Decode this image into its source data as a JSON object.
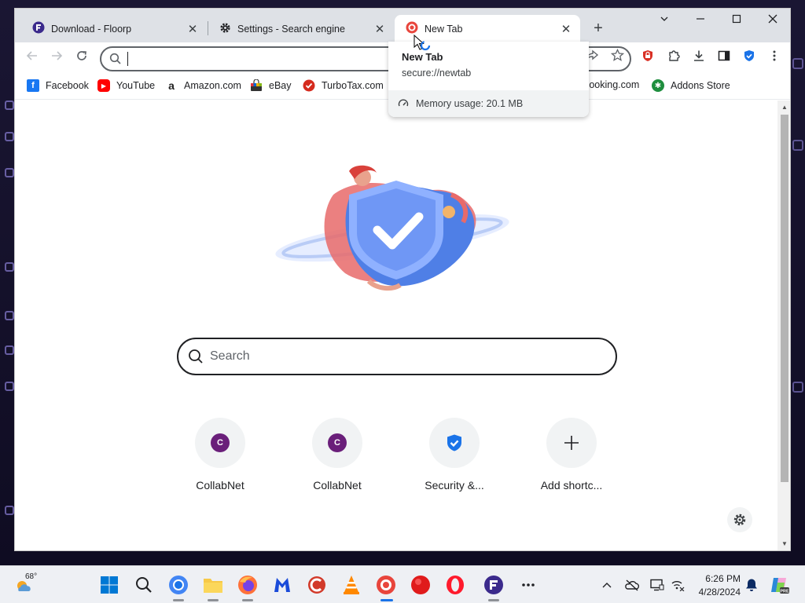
{
  "tabs": [
    {
      "title": "Download - Floorp",
      "favicon": "floorp-icon",
      "active": false
    },
    {
      "title": "Settings - Search engine",
      "favicon": "gear-icon",
      "active": false
    },
    {
      "title": "New Tab",
      "favicon": "browser-logo-icon",
      "active": true
    }
  ],
  "omnibox": {
    "value": "",
    "placeholder": ""
  },
  "bookmarks": [
    {
      "label": "Facebook",
      "icon": "facebook-icon",
      "color": "#1877f2"
    },
    {
      "label": "YouTube",
      "icon": "youtube-icon",
      "color": "#ff0000"
    },
    {
      "label": "Amazon.com",
      "icon": "amazon-icon",
      "color": "#222222"
    },
    {
      "label": "eBay",
      "icon": "ebay-icon",
      "color": "#e53238"
    },
    {
      "label": "TurboTax.com",
      "icon": "turbotax-icon",
      "color": "#d52b1e"
    },
    {
      "label": "Booking.com",
      "icon": "booking-icon",
      "color": "#003580"
    },
    {
      "label": "Addons Store",
      "icon": "addons-store-icon",
      "color": "#1e8e3e"
    }
  ],
  "hovercard": {
    "title": "New Tab",
    "url": "secure://newtab",
    "memory": "Memory usage: 20.1 MB"
  },
  "ntp": {
    "search_placeholder": "Search",
    "shortcuts": [
      {
        "label": "CollabNet",
        "letter": "C",
        "icon": "collabnet-icon"
      },
      {
        "label": "CollabNet",
        "letter": "C",
        "icon": "collabnet-icon"
      },
      {
        "label": "Security &...",
        "letter": "",
        "icon": "shield-icon"
      },
      {
        "label": "Add shortc...",
        "letter": "",
        "icon": "plus-icon"
      }
    ]
  },
  "taskbar": {
    "weather_temp": "68°",
    "time": "6:26 PM",
    "date": "4/28/2024"
  },
  "colors": {
    "accent_blue": "#1a73e8",
    "collabnet_purple": "#6a1f7a",
    "tabstrip_bg": "#dee1e6"
  }
}
